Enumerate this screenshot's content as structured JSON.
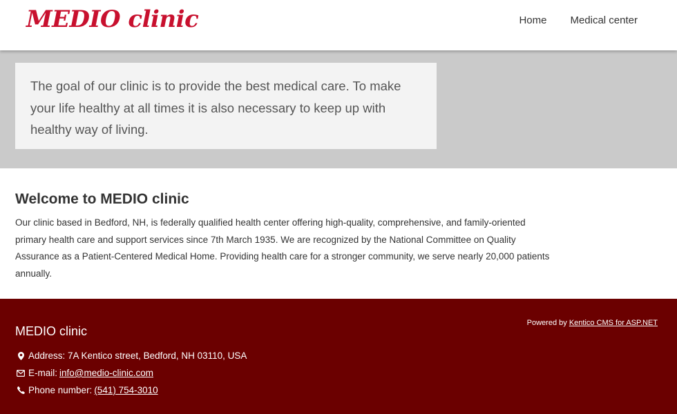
{
  "header": {
    "logo": "MEDIO clinic",
    "nav": [
      {
        "label": "Home"
      },
      {
        "label": "Medical center"
      }
    ]
  },
  "hero": {
    "text": "The goal of our clinic is to provide the best medical care. To make your life healthy at all times it is also necessary to keep up with healthy way of living."
  },
  "welcome": {
    "title": "Welcome to MEDIO clinic",
    "body": "Our clinic based in Bedford, NH, is federally qualified health center offering high-quality, comprehensive, and family-oriented primary health care and support services since 7th March 1935. We are recognized by the National Committee on Quality Assurance as a Patient-Centered Medical Home. Providing health care for a stronger community, we serve nearly 20,000 patients annually."
  },
  "footer": {
    "title": "MEDIO clinic",
    "powered_prefix": "Powered by",
    "powered_link": "Kentico CMS for ASP.NET",
    "address_label": "Address: 7A Kentico street, Bedford, NH 03110, USA",
    "email_label": "E-mail:",
    "email_value": "info@medio-clinic.com",
    "phone_label": "Phone number:",
    "phone_value": "(541) 754-3010",
    "icons": {
      "address": "map-marker-icon",
      "email": "envelope-icon",
      "phone": "phone-icon"
    }
  },
  "colors": {
    "brand": "#c8102e",
    "hero_band": "#cacaca",
    "hero_box": "#f3f3f3",
    "footer_bg": "#6b0000"
  }
}
